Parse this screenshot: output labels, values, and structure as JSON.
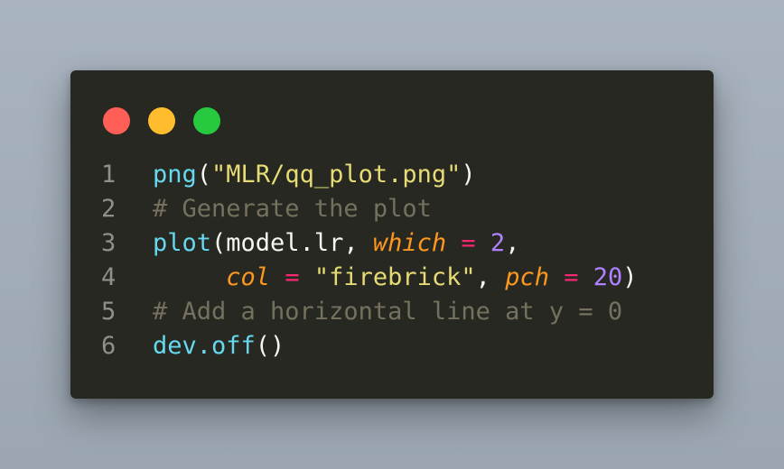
{
  "window": {
    "controls": {
      "close_color": "#ff5f56",
      "minimize_color": "#ffbd2e",
      "maximize_color": "#27c93f"
    }
  },
  "code": {
    "language": "R",
    "lines": [
      {
        "number": "1",
        "tokens": [
          {
            "type": "fn",
            "text": "png"
          },
          {
            "type": "pl",
            "text": "("
          },
          {
            "type": "str",
            "text": "\"MLR/qq_plot.png\""
          },
          {
            "type": "pl",
            "text": ")"
          }
        ]
      },
      {
        "number": "2",
        "tokens": [
          {
            "type": "cm",
            "text": "# Generate the plot"
          }
        ]
      },
      {
        "number": "3",
        "tokens": [
          {
            "type": "fn",
            "text": "plot"
          },
          {
            "type": "pl",
            "text": "(model.lr, "
          },
          {
            "type": "kw",
            "text": "which"
          },
          {
            "type": "pl",
            "text": " "
          },
          {
            "type": "op",
            "text": "="
          },
          {
            "type": "pl",
            "text": " "
          },
          {
            "type": "num",
            "text": "2"
          },
          {
            "type": "pl",
            "text": ","
          }
        ]
      },
      {
        "number": "4",
        "tokens": [
          {
            "type": "pl",
            "text": "     "
          },
          {
            "type": "kw",
            "text": "col"
          },
          {
            "type": "pl",
            "text": " "
          },
          {
            "type": "op",
            "text": "="
          },
          {
            "type": "pl",
            "text": " "
          },
          {
            "type": "str",
            "text": "\"firebrick\""
          },
          {
            "type": "pl",
            "text": ", "
          },
          {
            "type": "kw",
            "text": "pch"
          },
          {
            "type": "pl",
            "text": " "
          },
          {
            "type": "op",
            "text": "="
          },
          {
            "type": "pl",
            "text": " "
          },
          {
            "type": "num",
            "text": "20"
          },
          {
            "type": "pl",
            "text": ")"
          }
        ]
      },
      {
        "number": "5",
        "tokens": [
          {
            "type": "cm",
            "text": "# Add a horizontal line at y = 0"
          }
        ]
      },
      {
        "number": "6",
        "tokens": [
          {
            "type": "fn",
            "text": "dev.off"
          },
          {
            "type": "pl",
            "text": "()"
          }
        ]
      }
    ]
  },
  "theme": {
    "background": "#272822",
    "function": "#66d9ef",
    "string": "#e6db74",
    "comment": "#75715e",
    "argument": "#fd971f",
    "operator": "#f92672",
    "number": "#ae81ff",
    "plain": "#f8f8f2",
    "line_number": "#90908a"
  }
}
